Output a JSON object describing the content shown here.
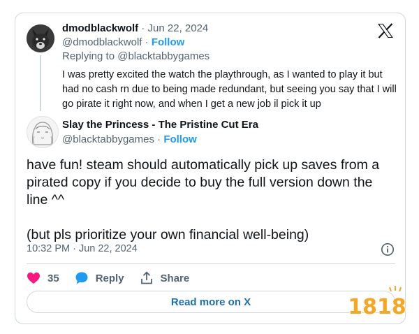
{
  "parent_tweet": {
    "display_name": "dmodblackwolf",
    "separator": "·",
    "date": "Jun 22, 2024",
    "handle": "@dmodblackwolf",
    "follow_label": "Follow",
    "replying_to_prefix": "Replying to",
    "replying_to_handle": "@blacktabbygames",
    "text": "I was pretty excited the watch the playthrough, as I wanted to play it but had no cash rn due to being made redundant, but seeing you say that I will go pirate it right now, and when I get a new job il pick it up"
  },
  "reply_tweet": {
    "display_name": "Slay the Princess - The Pristine Cut Era",
    "handle": "@blacktabbygames",
    "separator": "·",
    "follow_label": "Follow",
    "text_lines": [
      "have fun! steam should automatically pick up saves from a pirated copy if you decide to buy the full version down the line ^^",
      "(but pls prioritize your own financial well-being)"
    ],
    "timestamp": "10:32 PM · Jun 22, 2024"
  },
  "actions": {
    "like_count": "35",
    "reply_label": "Reply",
    "share_label": "Share"
  },
  "read_more_label": "Read more on X",
  "watermark_text": "1818",
  "colors": {
    "accent": "#1d9bf0",
    "like": "#f91880",
    "muted": "#536471",
    "border": "#cfd9de",
    "watermark": "#f6a623"
  },
  "icons": {
    "logo": "x-logo-icon",
    "info": "info-icon",
    "like": "heart-icon",
    "reply": "speech-bubble-icon",
    "share": "share-icon"
  }
}
